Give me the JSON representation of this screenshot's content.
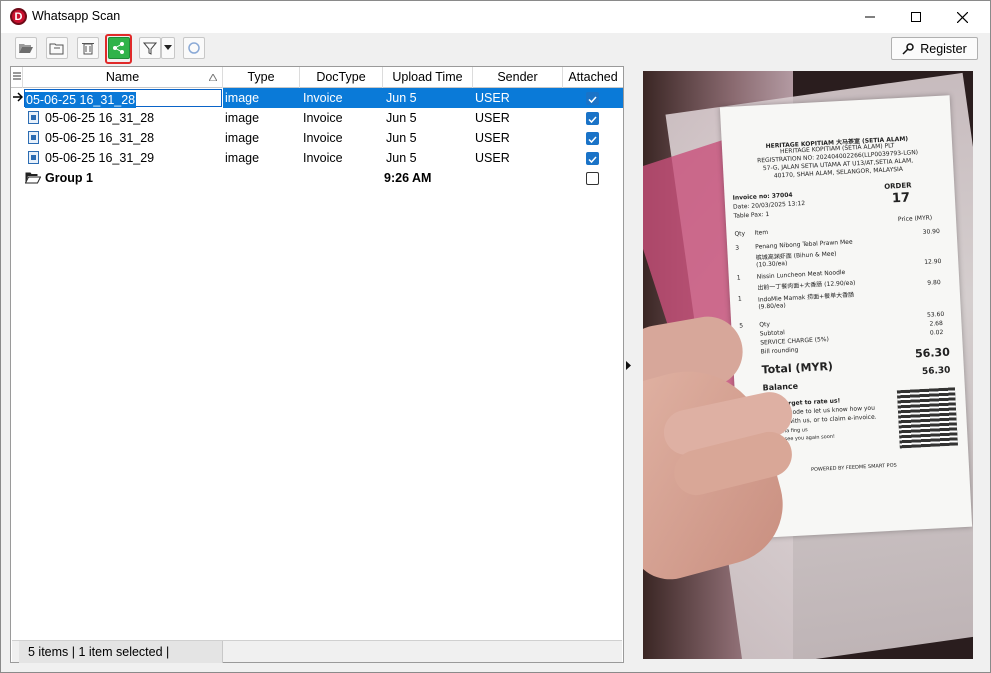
{
  "window": {
    "title": "Whatsapp Scan",
    "logo_letter": "D"
  },
  "toolbar": {
    "register_label": "Register"
  },
  "grid": {
    "columns": [
      "Name",
      "Type",
      "DocType",
      "Upload Time",
      "Sender",
      "Attached"
    ],
    "rows": [
      {
        "name": "05-06-25 16_31_28",
        "type": "image",
        "doctype": "Invoice",
        "upload_time": "Jun 5",
        "sender": "USER",
        "attached": true
      },
      {
        "name": "05-06-25 16_31_28",
        "type": "image",
        "doctype": "Invoice",
        "upload_time": "Jun 5",
        "sender": "USER",
        "attached": true
      },
      {
        "name": "05-06-25 16_31_28",
        "type": "image",
        "doctype": "Invoice",
        "upload_time": "Jun 5",
        "sender": "USER",
        "attached": true
      },
      {
        "name": "05-06-25 16_31_29",
        "type": "image",
        "doctype": "Invoice",
        "upload_time": "Jun 5",
        "sender": "USER",
        "attached": true
      }
    ],
    "group": {
      "name": "Group 1",
      "upload_time": "9:26 AM",
      "attached": false
    }
  },
  "status": {
    "text": "5 items |  1 item selected |"
  },
  "receipt": {
    "header1": "HERITAGE KOPITIAM 大马茶室 (SETIA ALAM)",
    "header2": "HERITAGE KOPITIAM (SETIA ALAM) PLT",
    "header3": "REGISTRATION NO: 202404002266(LLP0039793-LGN)",
    "header4": "57-G, JALAN SETIA UTAMA AT U13/AT,SETIA ALAM,",
    "header5": "40170, SHAH ALAM, SELANGOR, MALAYSIA",
    "invoice_no": "Invoice no: 37004",
    "date": "Date: 20/03/2025 13:12",
    "table": "Table Pax: 1",
    "order_label": "ORDER",
    "order_no": "17",
    "col_qty": "Qty",
    "col_item": "Item",
    "col_price": "Price (MYR)",
    "items": [
      {
        "qty": "3",
        "name": "Penang Nibong Tebal Prawn Mee",
        "sub": "槟城高渊虾面 (Bihun & Mee)",
        "note": "(10.30/ea)",
        "price": "30.90"
      },
      {
        "qty": "1",
        "name": "Nissin Luncheon Meat Noodle",
        "sub": "出前一丁餐肉面+大香肠 (12.90/ea)",
        "note": "",
        "price": "12.90"
      },
      {
        "qty": "1",
        "name": "IndoMie Mamak 捞面+餐单大香肠",
        "sub": "(9.80/ea)",
        "note": "",
        "price": "9.80"
      }
    ],
    "total_qty_label": "Qty",
    "total_qty": "5",
    "subtotal_label": "Subtotal",
    "subtotal": "53.60",
    "service_label": "SERVICE CHARGE (5%)",
    "service": "2.68",
    "rounding_label": "Bill rounding",
    "rounding": "0.02",
    "total_label": "Total (MYR)",
    "total": "56.30",
    "balance_label": "Balance",
    "balance": "56.30",
    "rate_title": "Don't forget to rate us!",
    "rate_line1": "Scan QR code to let us know how you",
    "rate_line2": "enjoyed with us, or to claim e-invoice.",
    "rate_line3": "Like us via fing us",
    "rate_line4": "Hope to see you again soon!",
    "footer": "POWERED BY FEEDME SMART POS"
  }
}
